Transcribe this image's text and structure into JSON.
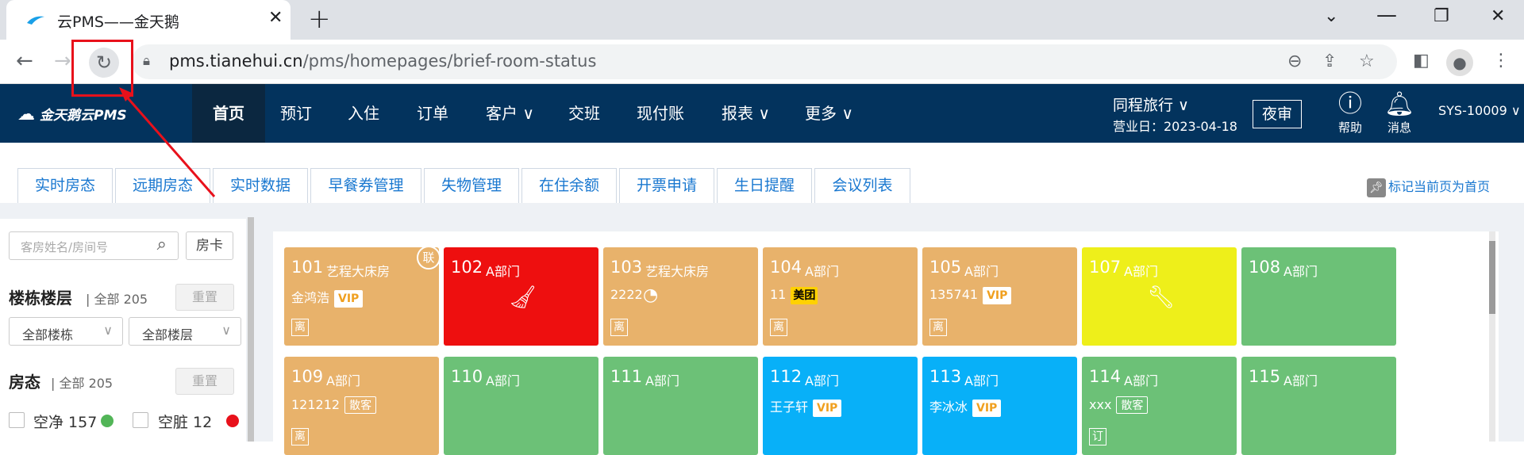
{
  "browser": {
    "tab_title": "云PMS——金天鹅",
    "url_host": "pms.tianehui.cn",
    "url_path": "/pms/homepages/brief-room-status"
  },
  "header": {
    "logo": "金天鹅云PMS",
    "menu": [
      "首页",
      "预订",
      "入住",
      "订单",
      "客户 ∨",
      "交班",
      "现付账",
      "报表 ∨",
      "更多 ∨"
    ],
    "hotel": "同程旅行 ∨",
    "business_date": "营业日：2023-04-18",
    "night_audit": "夜审",
    "help": "帮助",
    "messages": "消息",
    "user": "SYS-10009 ∨"
  },
  "subtabs": [
    "实时房态",
    "远期房态",
    "实时数据",
    "早餐券管理",
    "失物管理",
    "在住余额",
    "开票申请",
    "生日提醒",
    "会议列表"
  ],
  "pin_label": "标记当前页为首页",
  "sidebar": {
    "search_placeholder": "客房姓名/房间号",
    "room_card": "房卡",
    "building_title": "楼栋楼层",
    "building_count": "全部 205",
    "reset": "重置",
    "all_buildings": "全部楼栋",
    "all_floors": "全部楼层",
    "status_title": "房态",
    "status_count": "全部 205",
    "statuses": [
      {
        "label": "空净 157",
        "color": "#52b557"
      },
      {
        "label": "空脏 12",
        "color": "#e8111b"
      }
    ]
  },
  "rooms": [
    {
      "no": "101",
      "type": "艺程大床房",
      "guest": "金鸿浩",
      "tag": "VIP",
      "small": "离",
      "color": "#e8b26b",
      "lian": "联"
    },
    {
      "no": "102",
      "type": "A部门",
      "color": "#ee0f0f",
      "icon": "broom-icon"
    },
    {
      "no": "103",
      "type": "艺程大床房",
      "guest": "2222",
      "small": "离",
      "color": "#e8b26b",
      "icon": "spinner-icon"
    },
    {
      "no": "104",
      "type": "A部门",
      "guest": "11",
      "tag": "美团",
      "tag_style": "meituan",
      "small": "离",
      "color": "#e8b26b"
    },
    {
      "no": "105",
      "type": "A部门",
      "guest": "135741",
      "tag": "VIP",
      "small": "离",
      "color": "#e8b26b"
    },
    {
      "no": "107",
      "type": "A部门",
      "color": "#eeef1a",
      "icon": "wrench-icon"
    },
    {
      "no": "108",
      "type": "A部门",
      "color": "#6cc177"
    },
    {
      "no": "109",
      "type": "A部门",
      "guest": "121212",
      "tag": "散客",
      "tag_style": "plain",
      "small": "离",
      "color": "#e8b26b"
    },
    {
      "no": "110",
      "type": "A部门",
      "color": "#6cc177"
    },
    {
      "no": "111",
      "type": "A部门",
      "color": "#6cc177"
    },
    {
      "no": "112",
      "type": "A部门",
      "guest": "王子轩",
      "tag": "VIP",
      "color": "#08b0f8"
    },
    {
      "no": "113",
      "type": "A部门",
      "guest": "李冰冰",
      "tag": "VIP",
      "color": "#08b0f8"
    },
    {
      "no": "114",
      "type": "A部门",
      "guest": "xxx",
      "tag": "散客",
      "tag_style": "plain",
      "small": "订",
      "color": "#6cc177"
    },
    {
      "no": "115",
      "type": "A部门",
      "color": "#6cc177"
    }
  ]
}
